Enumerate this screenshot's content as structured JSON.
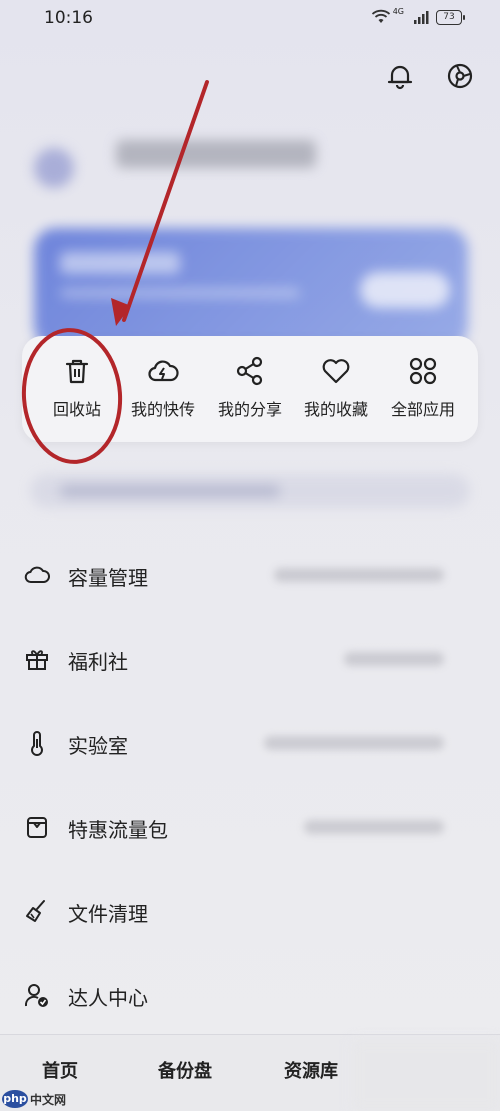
{
  "status_bar": {
    "time": "10:16",
    "network": "4G",
    "battery": "73"
  },
  "header": {
    "bell_icon": "bell-icon",
    "settings_icon": "settings-icon"
  },
  "quick_actions": [
    {
      "label": "回收站",
      "icon": "trash-icon"
    },
    {
      "label": "我的快传",
      "icon": "cloud-bolt-icon"
    },
    {
      "label": "我的分享",
      "icon": "share-icon"
    },
    {
      "label": "我的收藏",
      "icon": "heart-icon"
    },
    {
      "label": "全部应用",
      "icon": "grid-circles-icon"
    }
  ],
  "menu": [
    {
      "label": "容量管理",
      "icon": "cloud-icon"
    },
    {
      "label": "福利社",
      "icon": "gift-icon"
    },
    {
      "label": "实验室",
      "icon": "thermometer-icon"
    },
    {
      "label": "特惠流量包",
      "icon": "package-icon"
    },
    {
      "label": "文件清理",
      "icon": "broom-icon"
    },
    {
      "label": "达人中心",
      "icon": "user-check-icon"
    }
  ],
  "bottom_nav": [
    {
      "label": "首页"
    },
    {
      "label": "备份盘"
    },
    {
      "label": "资源库"
    }
  ],
  "watermark": {
    "logo": "php",
    "text": "中文网"
  },
  "colors": {
    "accent_blue": "#5a74d8",
    "annotation_red": "#b3262a",
    "background": "#e9e9ef"
  }
}
